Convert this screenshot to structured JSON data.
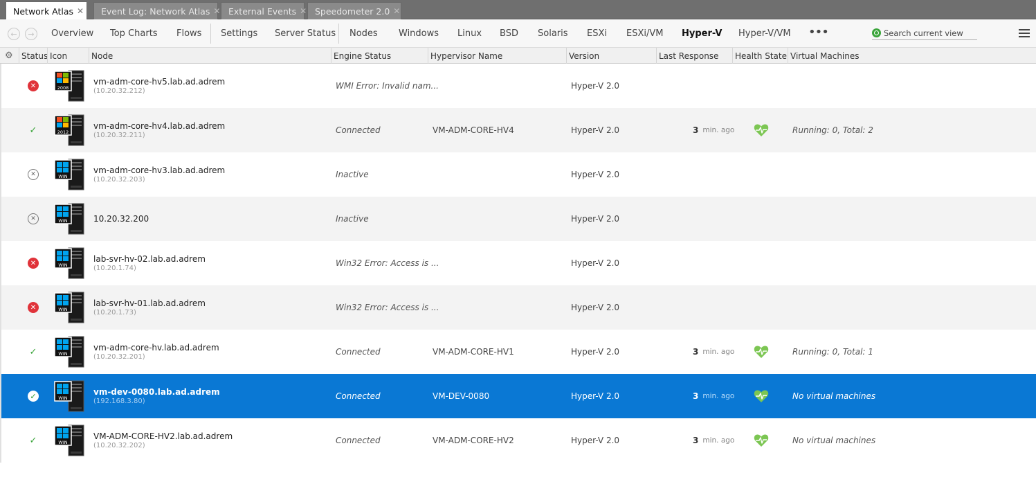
{
  "tabs": [
    {
      "label": "Network Atlas",
      "active": true
    },
    {
      "label": "Event Log: Network Atlas",
      "active": false
    },
    {
      "label": "External Events",
      "active": false
    },
    {
      "label": "Speedometer 2.0",
      "active": false
    }
  ],
  "nav": {
    "items": [
      "Overview",
      "Top Charts",
      "Flows",
      "Settings",
      "Server Status",
      "Nodes",
      "Windows",
      "Linux",
      "BSD",
      "Solaris",
      "ESXi",
      "ESXi/VM",
      "Hyper-V",
      "Hyper-V/VM"
    ],
    "active": "Hyper-V",
    "more": "•••",
    "search_placeholder": "Search current view"
  },
  "columns": [
    "Status",
    "Icon",
    "Node",
    "Engine Status",
    "Hypervisor Name",
    "Version",
    "Last Response",
    "Health State",
    "Virtual Machines"
  ],
  "rows": [
    {
      "status": "error",
      "os": "2008",
      "name": "vm-adm-core-hv5.lab.ad.adrem",
      "ip": "(10.20.32.212)",
      "engine": "WMI Error: Invalid nam...",
      "hypervisor": "",
      "version": "Hyper-V 2.0",
      "response_value": "",
      "response_unit": "",
      "health": "",
      "vms": ""
    },
    {
      "status": "ok",
      "os": "2012",
      "name": "vm-adm-core-hv4.lab.ad.adrem",
      "ip": "(10.20.32.211)",
      "engine": "Connected",
      "hypervisor": "VM-ADM-CORE-HV4",
      "version": "Hyper-V 2.0",
      "response_value": "3",
      "response_unit": "min. ago",
      "health": "heart-icon",
      "vms": "Running: 0, Total: 2"
    },
    {
      "status": "inactive",
      "os": "WIN",
      "name": "vm-adm-core-hv3.lab.ad.adrem",
      "ip": "(10.20.32.203)",
      "engine": "Inactive",
      "hypervisor": "",
      "version": "Hyper-V 2.0",
      "response_value": "",
      "response_unit": "",
      "health": "",
      "vms": ""
    },
    {
      "status": "inactive",
      "os": "WIN",
      "name": "10.20.32.200",
      "ip": "",
      "engine": "Inactive",
      "hypervisor": "",
      "version": "Hyper-V 2.0",
      "response_value": "",
      "response_unit": "",
      "health": "",
      "vms": ""
    },
    {
      "status": "error",
      "os": "WIN",
      "name": "lab-svr-hv-02.lab.ad.adrem",
      "ip": "(10.20.1.74)",
      "engine": "Win32 Error: Access is ...",
      "hypervisor": "",
      "version": "Hyper-V 2.0",
      "response_value": "",
      "response_unit": "",
      "health": "",
      "vms": ""
    },
    {
      "status": "error",
      "os": "WIN",
      "name": "lab-svr-hv-01.lab.ad.adrem",
      "ip": "(10.20.1.73)",
      "engine": "Win32 Error: Access is ...",
      "hypervisor": "",
      "version": "Hyper-V 2.0",
      "response_value": "",
      "response_unit": "",
      "health": "",
      "vms": ""
    },
    {
      "status": "ok",
      "os": "WIN",
      "name": "vm-adm-core-hv.lab.ad.adrem",
      "ip": "(10.20.32.201)",
      "engine": "Connected",
      "hypervisor": "VM-ADM-CORE-HV1",
      "version": "Hyper-V 2.0",
      "response_value": "3",
      "response_unit": "min. ago",
      "health": "heart-icon",
      "vms": "Running: 0, Total: 1"
    },
    {
      "status": "ok",
      "os": "WIN",
      "selected": true,
      "name": "vm-dev-0080.lab.ad.adrem",
      "ip": "(192.168.3.80)",
      "engine": "Connected",
      "hypervisor": "VM-DEV-0080",
      "version": "Hyper-V 2.0",
      "response_value": "3",
      "response_unit": "min. ago",
      "health": "heart-icon",
      "vms": "No virtual machines"
    },
    {
      "status": "ok",
      "os": "WIN",
      "name": "VM-ADM-CORE-HV2.lab.ad.adrem",
      "ip": "(10.20.32.202)",
      "engine": "Connected",
      "hypervisor": "VM-ADM-CORE-HV2",
      "version": "Hyper-V 2.0",
      "response_value": "3",
      "response_unit": "min. ago",
      "health": "heart-icon",
      "vms": "No virtual machines"
    }
  ],
  "colors": {
    "selected": "#0a78d4",
    "ok": "#3aa43a",
    "error": "#e0333a",
    "health": "#7cc653"
  }
}
